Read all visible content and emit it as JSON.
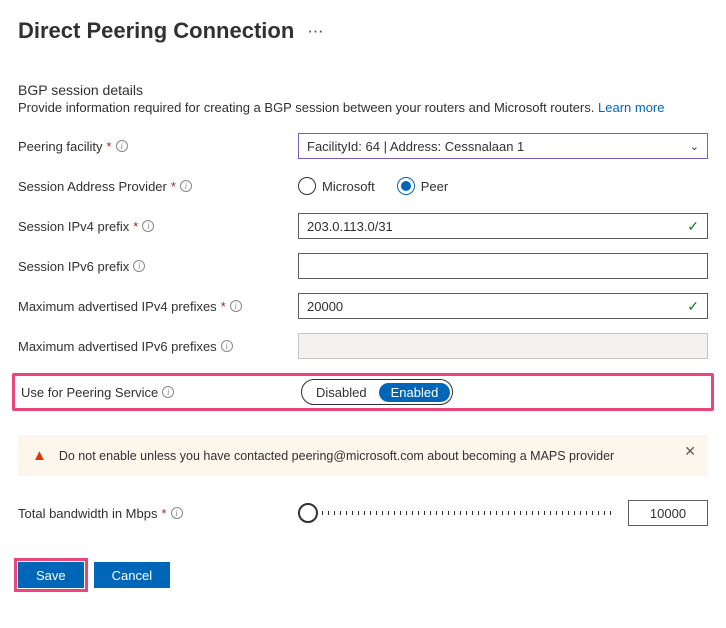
{
  "header": {
    "title": "Direct Peering Connection",
    "more": "···"
  },
  "section": {
    "title": "BGP session details",
    "desc": "Provide information required for creating a BGP session between your routers and Microsoft routers. ",
    "learn_more": "Learn more"
  },
  "labels": {
    "facility": "Peering facility",
    "sap": "Session Address Provider",
    "v4prefix": "Session IPv4 prefix",
    "v6prefix": "Session IPv6 prefix",
    "max_v4": "Maximum advertised IPv4 prefixes",
    "max_v6": "Maximum advertised IPv6 prefixes",
    "use_ps": "Use for Peering Service",
    "bandwidth": "Total bandwidth in Mbps"
  },
  "values": {
    "facility": "FacilityId: 64 | Address: Cessnalaan 1",
    "sap_options": {
      "a": "Microsoft",
      "b": "Peer"
    },
    "v4prefix": "203.0.113.0/31",
    "v6prefix": "",
    "max_v4": "20000",
    "max_v6": "",
    "toggle": {
      "off": "Disabled",
      "on": "Enabled"
    },
    "bandwidth": "10000"
  },
  "alert": {
    "text": "Do not enable unless you have contacted peering@microsoft.com about becoming a MAPS provider"
  },
  "footer": {
    "save": "Save",
    "cancel": "Cancel"
  }
}
